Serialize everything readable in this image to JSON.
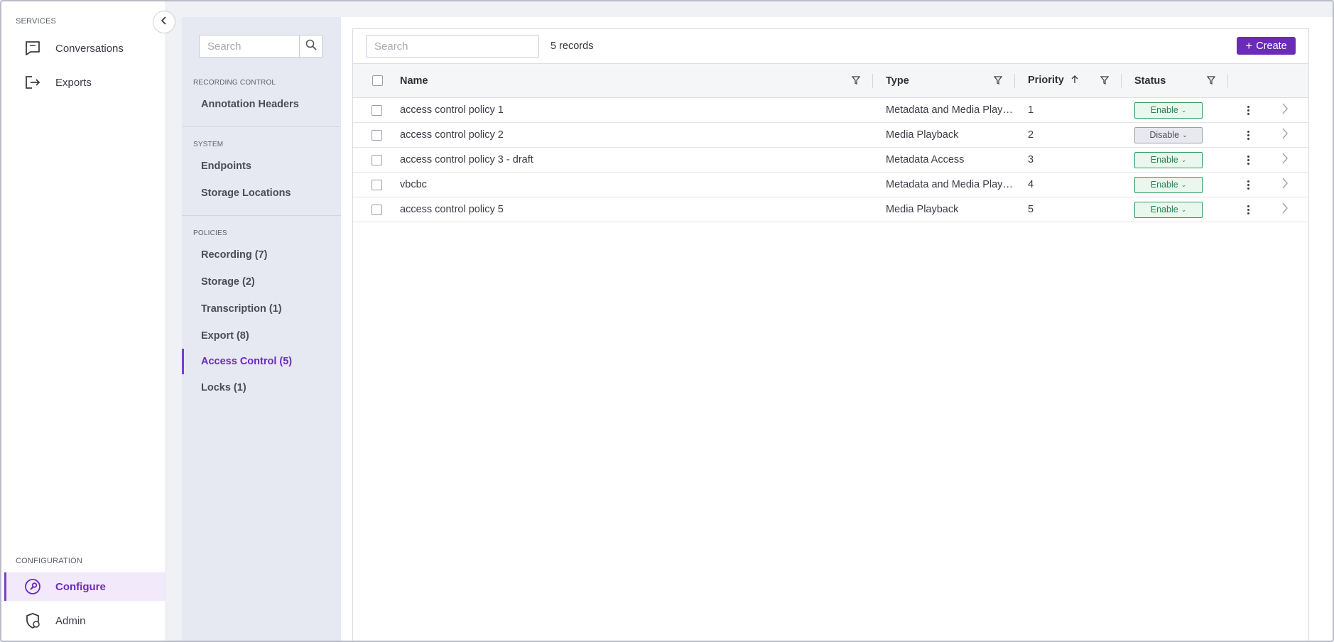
{
  "leftnav": {
    "services_label": "SERVICES",
    "services": [
      {
        "label": "Conversations",
        "icon": "chat-icon"
      },
      {
        "label": "Exports",
        "icon": "export-icon"
      }
    ],
    "configuration_label": "CONFIGURATION",
    "configuration": [
      {
        "label": "Configure",
        "icon": "wrench-icon",
        "active": true
      },
      {
        "label": "Admin",
        "icon": "admin-shield-icon",
        "active": false
      }
    ]
  },
  "subnav": {
    "search_placeholder": "Search",
    "sections": [
      {
        "label": "RECORDING CONTROL",
        "items": [
          {
            "label": "Annotation Headers"
          }
        ]
      },
      {
        "label": "SYSTEM",
        "items": [
          {
            "label": "Endpoints"
          },
          {
            "label": "Storage Locations"
          }
        ]
      },
      {
        "label": "POLICIES",
        "items": [
          {
            "label": "Recording (7)"
          },
          {
            "label": "Storage (2)"
          },
          {
            "label": "Transcription (1)"
          },
          {
            "label": "Export (8)"
          },
          {
            "label": "Access Control (5)",
            "active": true
          },
          {
            "label": "Locks (1)"
          }
        ]
      }
    ]
  },
  "main": {
    "search_placeholder": "Search",
    "records_count": "5 records",
    "create_label": "Create",
    "columns": {
      "name": "Name",
      "type": "Type",
      "priority": "Priority",
      "status": "Status"
    },
    "sort": {
      "column": "priority",
      "direction": "ascending"
    },
    "rows": [
      {
        "name": "access control policy 1",
        "type": "Metadata and Media Playback",
        "priority": "1",
        "status": "Enable"
      },
      {
        "name": "access control policy 2",
        "type": "Media Playback",
        "priority": "2",
        "status": "Disable"
      },
      {
        "name": "access control policy 3 - draft",
        "type": "Metadata Access",
        "priority": "3",
        "status": "Enable"
      },
      {
        "name": "vbcbc",
        "type": "Metadata and Media Playback",
        "priority": "4",
        "status": "Enable"
      },
      {
        "name": "access control policy 5",
        "type": "Media Playback",
        "priority": "5",
        "status": "Enable"
      }
    ]
  },
  "colors": {
    "accent": "#6a2bb8",
    "enable_green": "#2e9d5a",
    "disable_gray": "#9ea1ab"
  }
}
